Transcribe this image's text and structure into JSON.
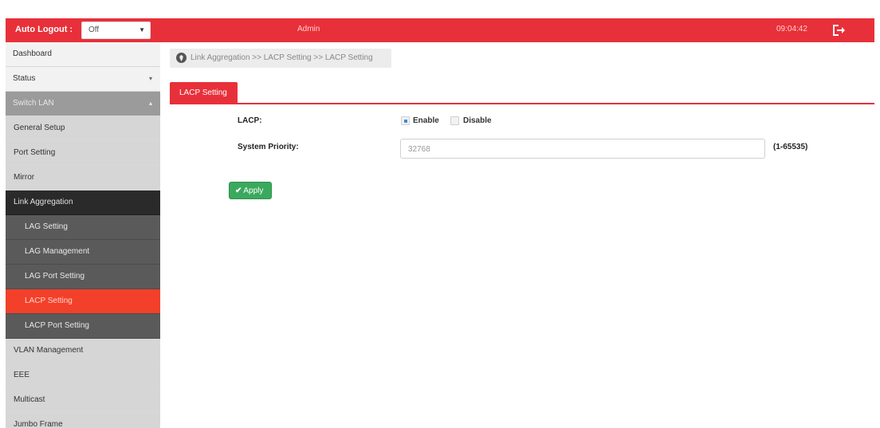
{
  "header": {
    "auto_logout_label": "Auto Logout :",
    "auto_logout_value": "Off",
    "user": "Admin",
    "clock": "09:04:42"
  },
  "sidebar": {
    "items": [
      {
        "label": "Dashboard"
      },
      {
        "label": "Status"
      },
      {
        "label": "Switch LAN"
      },
      {
        "label": "General Setup"
      },
      {
        "label": "Port Setting"
      },
      {
        "label": "Mirror"
      },
      {
        "label": "Link Aggregation"
      },
      {
        "label": "LAG Setting"
      },
      {
        "label": "LAG Management"
      },
      {
        "label": "LAG Port Setting"
      },
      {
        "label": "LACP Setting"
      },
      {
        "label": "LACP Port Setting"
      },
      {
        "label": "VLAN Management"
      },
      {
        "label": "EEE"
      },
      {
        "label": "Multicast"
      },
      {
        "label": "Jumbo Frame"
      }
    ]
  },
  "breadcrumb": {
    "text": "Link Aggregation  >>  LACP Setting  >>  LACP Setting"
  },
  "tabs": [
    {
      "label": "LACP Setting"
    }
  ],
  "form": {
    "lacp_label": "LACP:",
    "enable_label": "Enable",
    "disable_label": "Disable",
    "lacp_value": "Enable",
    "priority_label": "System Priority:",
    "priority_value": "32768",
    "priority_range": "(1-65535)",
    "apply_label": "Apply"
  },
  "colors": {
    "brand_red": "#e8303a",
    "active_item": "#f2402a",
    "apply_green": "#3aa95d"
  }
}
